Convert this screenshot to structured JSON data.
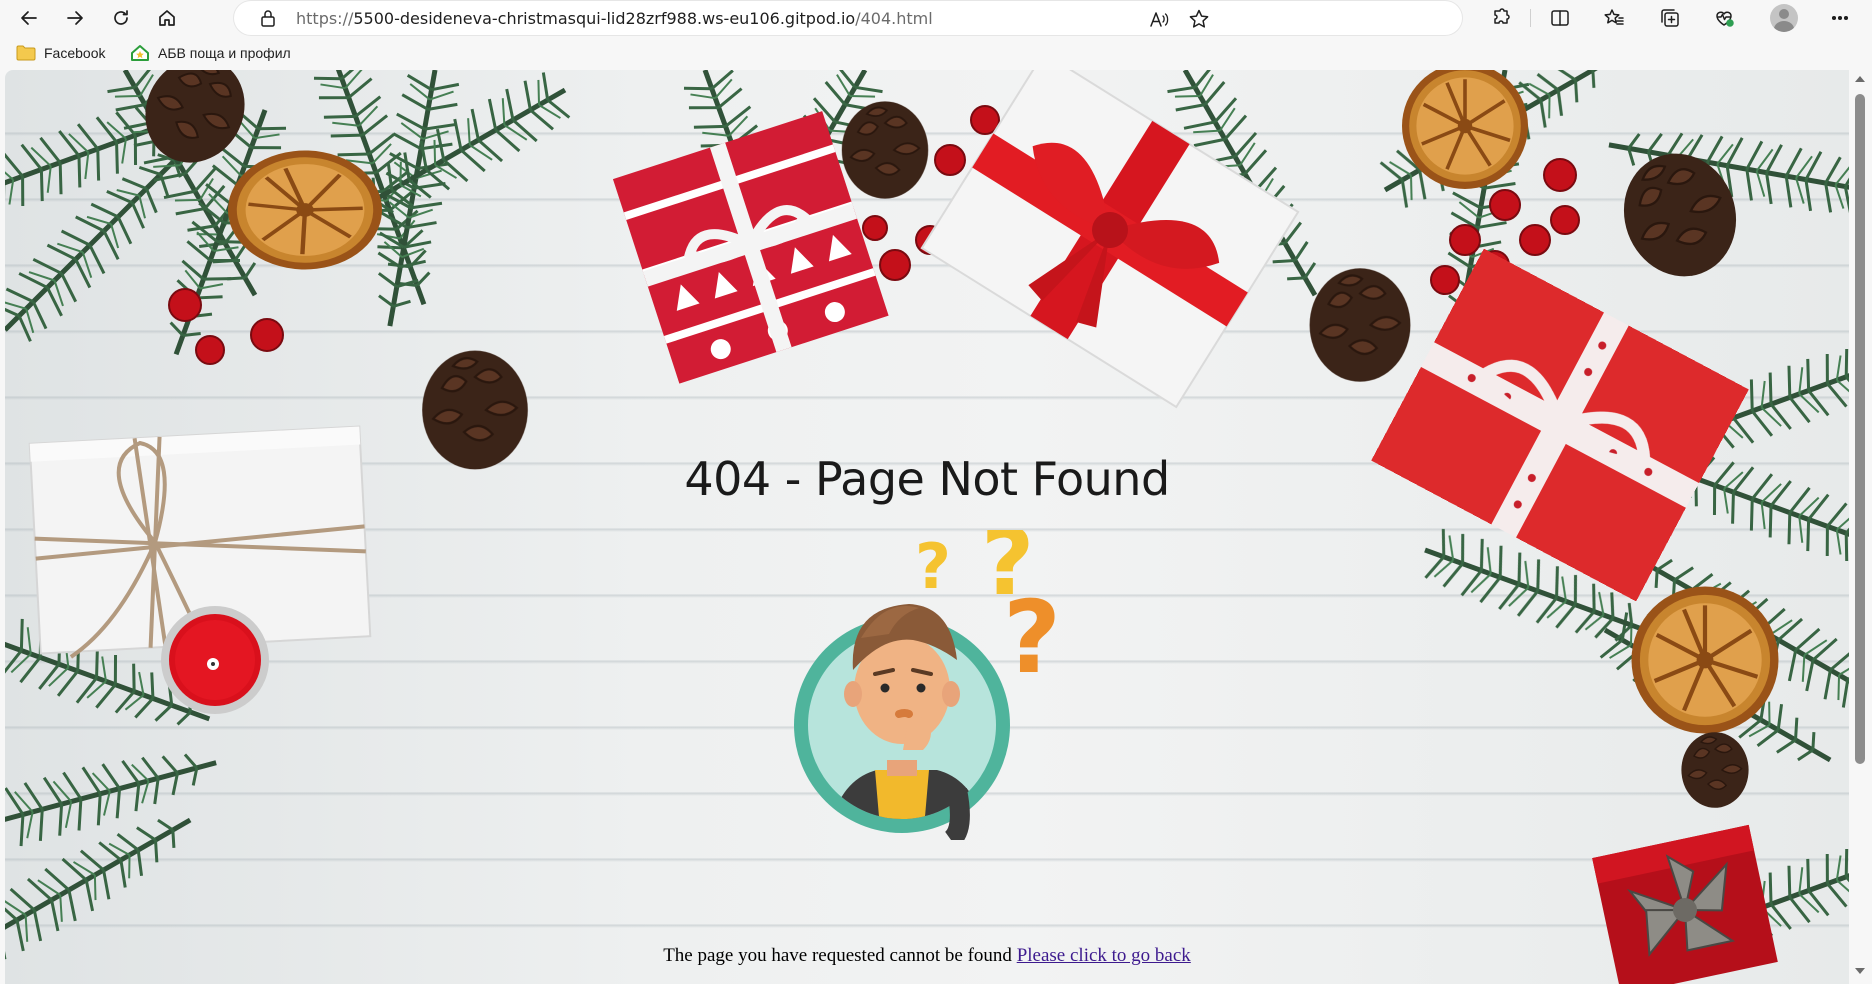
{
  "browser": {
    "url_prefix": "https://",
    "url_host": "5500-desideneva-christmasqui-lid28zrf988.ws-eu106.gitpod.io",
    "url_path": "/404.html",
    "icons": {
      "back": "back-arrow-icon",
      "forward": "forward-arrow-icon",
      "refresh": "refresh-icon",
      "home": "home-icon",
      "lock": "site-info-icon",
      "read_aloud": "read-aloud-icon",
      "favorite": "star-icon",
      "extensions": "puzzle-icon",
      "split_screen": "split-screen-icon",
      "favorites_bar": "favorites-icon",
      "collections": "collections-icon",
      "performance": "heart-pulse-icon",
      "profile": "avatar",
      "menu": "more-icon"
    }
  },
  "bookmarks": [
    {
      "label": "Facebook",
      "icon": "folder-icon"
    },
    {
      "label": "АБВ поща и профил",
      "icon": "abv-house-icon"
    }
  ],
  "page": {
    "title": "404 - Page Not Found",
    "message": "The page you have requested cannot be found",
    "back_link": "Please click to go back",
    "colors": {
      "link": "#3d1a8e",
      "circle_outer": "#4fb49c",
      "circle_inner": "#b7e4dc",
      "question_yellow": "#f5c330",
      "question_orange": "#ee8f2a"
    }
  }
}
